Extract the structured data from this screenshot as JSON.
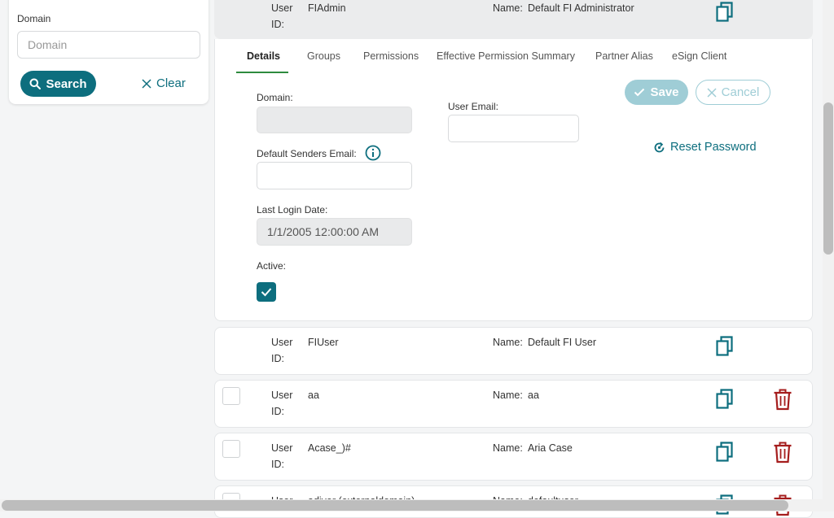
{
  "search": {
    "domain_label": "Domain",
    "domain_placeholder": "Domain",
    "search_label": "Search",
    "clear_label": "Clear"
  },
  "labels": {
    "user_id_line1": "User",
    "user_id_line2": "ID:",
    "name": "Name:"
  },
  "users": [
    {
      "user_id": "FIAdmin",
      "name": "Default FI Administrator"
    },
    {
      "user_id": "FIUser",
      "name": "Default FI User"
    },
    {
      "user_id": "aa",
      "name": "aa"
    },
    {
      "user_id": "Acase_)#",
      "name": "Aria Case"
    },
    {
      "user_id": "adiyer (externaldomain)",
      "name": "defaultuser"
    }
  ],
  "tabs": [
    "Details",
    "Groups",
    "Permissions",
    "Effective Permission Summary",
    "Partner Alias",
    "eSign Client"
  ],
  "details": {
    "domain_label": "Domain:",
    "domain_value": "",
    "user_email_label": "User Email:",
    "user_email_value": "",
    "default_senders_email_label": "Default Senders Email:",
    "default_senders_email_value": "",
    "last_login_label": "Last Login Date:",
    "last_login_value": "1/1/2005 12:00:00 AM",
    "active_label": "Active:",
    "active_checked": true,
    "save_label": "Save",
    "cancel_label": "Cancel",
    "reset_password_label": "Reset Password"
  },
  "colors": {
    "primary": "#0d6e7e",
    "tab_active_underline": "#2e8b3e",
    "delete_red": "#a51d1d",
    "save_disabled": "#9fcdd6"
  }
}
